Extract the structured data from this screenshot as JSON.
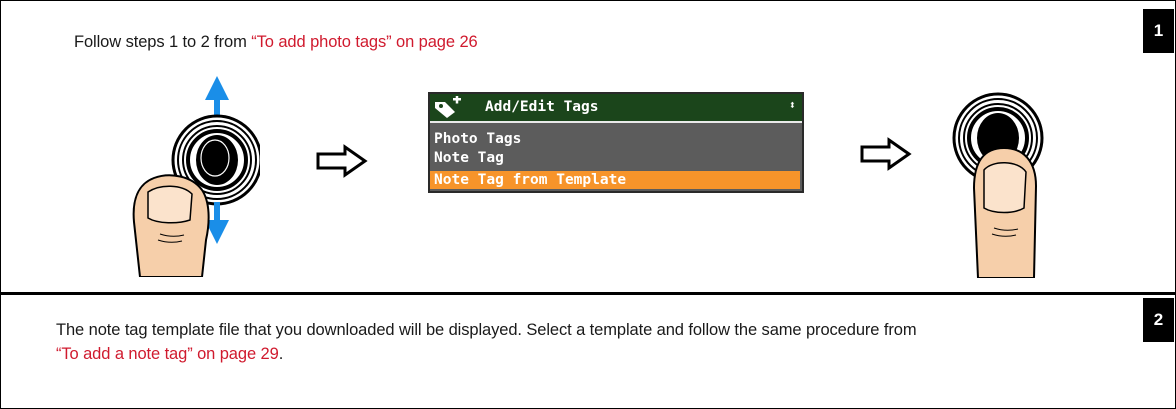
{
  "step1": {
    "badge": "1",
    "instruction_prefix": "Follow steps 1 to 2 from ",
    "instruction_link": "“To add photo tags” on page 26",
    "screen": {
      "icon": "tag-plus-icon",
      "title": "Add/Edit Tags",
      "scroll_indicator": "⬍",
      "items": [
        {
          "label": "Photo Tags",
          "selected": false
        },
        {
          "label": "Note Tag",
          "selected": false
        },
        {
          "label": "Note Tag from Template",
          "selected": true
        }
      ]
    }
  },
  "step2": {
    "badge": "2",
    "text_line1": "The note tag template file that you downloaded will be displayed. Select a template and follow the same procedure from",
    "link": "“To add a note tag” on page 29",
    "text_end": "."
  },
  "colors": {
    "link": "#d01a2e",
    "lcd_header": "#1b451b",
    "lcd_body": "#5c5c5c",
    "lcd_selected": "#f7942a",
    "arrow_blue": "#1a8ee8",
    "skin": "#f6cfaa"
  }
}
